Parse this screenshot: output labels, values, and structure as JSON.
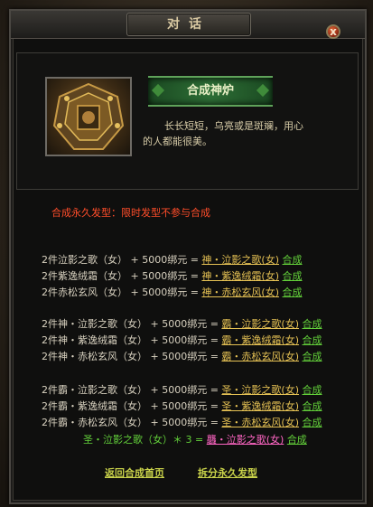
{
  "window": {
    "title": "对话",
    "close_label": "x"
  },
  "npc": {
    "name": "合成神炉",
    "desc_line1": "长长短短，乌亮或是斑斓，用心",
    "desc_line2": "的人都能很美。"
  },
  "notice": "合成永久发型：限时发型不参与合成",
  "recipe_groups": [
    [
      {
        "input": "2件泣影之歌（女）",
        "cost": "+ 5000绑元 =",
        "output": "神・泣影之歌(女)",
        "action": "合成"
      },
      {
        "input": "2件紫逸绒霜（女）",
        "cost": "+ 5000绑元 =",
        "output": "神・紫逸绒霜(女)",
        "action": "合成"
      },
      {
        "input": "2件赤松玄风（女）",
        "cost": "+ 5000绑元 =",
        "output": "神・赤松玄风(女)",
        "action": "合成"
      }
    ],
    [
      {
        "input": "2件神・泣影之歌（女）",
        "cost": "+ 5000绑元 =",
        "output": "霸・泣影之歌(女)",
        "action": "合成"
      },
      {
        "input": "2件神・紫逸绒霜（女）",
        "cost": "+ 5000绑元 =",
        "output": "霸・紫逸绒霜(女)",
        "action": "合成"
      },
      {
        "input": "2件神・赤松玄风（女）",
        "cost": "+ 5000绑元 =",
        "output": "霸・赤松玄风(女)",
        "action": "合成"
      }
    ],
    [
      {
        "input": "2件霸・泣影之歌（女）",
        "cost": "+ 5000绑元 =",
        "output": "圣・泣影之歌(女)",
        "action": "合成"
      },
      {
        "input": "2件霸・紫逸绒霜（女）",
        "cost": "+ 5000绑元 =",
        "output": "圣・紫逸绒霜(女)",
        "action": "合成"
      },
      {
        "input": "2件霸・赤松玄风（女）",
        "cost": "+ 5000绑元 =",
        "output": "圣・赤松玄风(女)",
        "action": "合成"
      }
    ]
  ],
  "special": {
    "input": "圣・泣影之歌（女）＊ 3 =",
    "output": "龘・泣影之歌(女)",
    "action": "合成"
  },
  "buttons": {
    "back": "返回合成首页",
    "split": "拆分永久发型"
  },
  "colors": {
    "notice": "#ff4d2a",
    "link_gold": "#e6c254",
    "link_green": "#63d13a",
    "link_magenta": "#ff66c4"
  }
}
